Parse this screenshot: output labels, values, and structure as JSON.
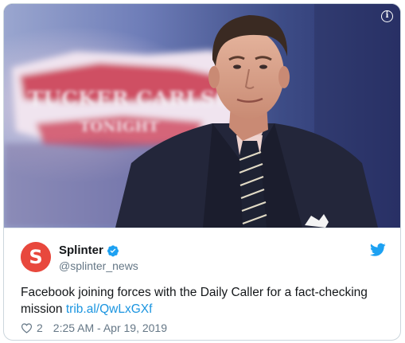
{
  "tweet": {
    "author_name": "Splinter",
    "author_handle": "@splinter_news",
    "avatar_letter": "S",
    "text": "Facebook joining forces with the Daily Caller for a fact-checking mission ",
    "link_text": "trib.al/QwLxGXf",
    "like_count": "2",
    "timestamp": "2:25 AM - Apr 19, 2019"
  },
  "media": {
    "info_glyph": "i",
    "backdrop_text": "TUCKER CARLSON",
    "backdrop_subtext": "TONIGHT"
  },
  "icons": [
    "info-icon",
    "verified-badge-icon",
    "twitter-bird-icon",
    "heart-icon"
  ],
  "colors": {
    "link": "#1b95e0",
    "verified": "#1da1f2",
    "avatar_bg": "#e8483d",
    "muted_text": "#657786",
    "border": "#ccd6dd"
  }
}
